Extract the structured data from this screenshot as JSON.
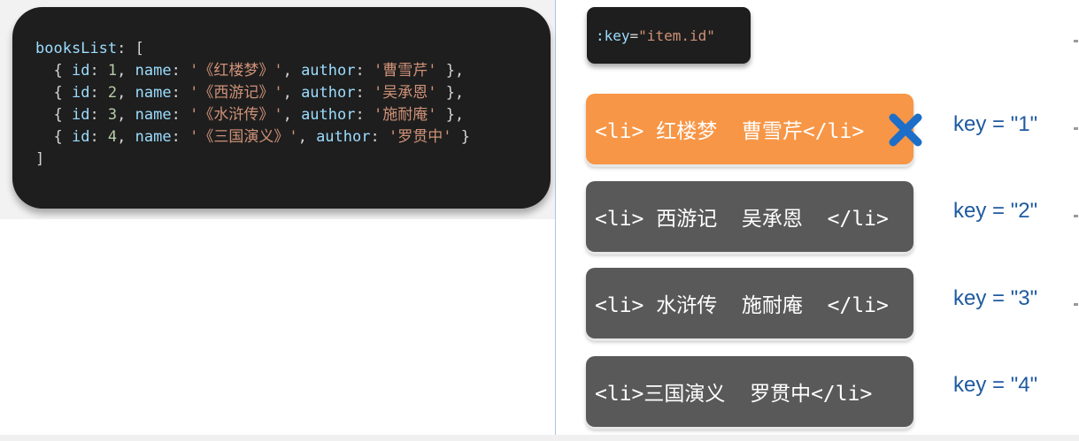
{
  "code": {
    "var": "booksList",
    "items": [
      {
        "id": "1",
        "name": "'《红楼梦》'",
        "author": "'曹雪芹'"
      },
      {
        "id": "2",
        "name": "'《西游记》'",
        "author": "'吴承恩'"
      },
      {
        "id": "3",
        "name": "'《水浒传》'",
        "author": "'施耐庵'"
      },
      {
        "id": "4",
        "name": "'《三国演义》'",
        "author": "'罗贯中'"
      }
    ]
  },
  "key_binding": {
    "attr": ":key",
    "value": "\"item.id\""
  },
  "list_items": [
    {
      "text": "<li> 红楼梦  曹雪芹</li>",
      "key": "key = \"1\"",
      "color": "#f79646"
    },
    {
      "text": "<li> 西游记  吴承恩  </li>",
      "key": "key = \"2\"",
      "color": "#595959"
    },
    {
      "text": "<li> 水浒传  施耐庵  </li>",
      "key": "key = \"3\"",
      "color": "#595959"
    },
    {
      "text": "<li>三国演义  罗贯中</li>",
      "key": "key = \"4\"",
      "color": "#595959"
    }
  ],
  "colors": {
    "removed_marker": "#1c6ec9",
    "key_label": "#1f5aa0"
  },
  "icons": {
    "removed": "x-mark-icon"
  }
}
